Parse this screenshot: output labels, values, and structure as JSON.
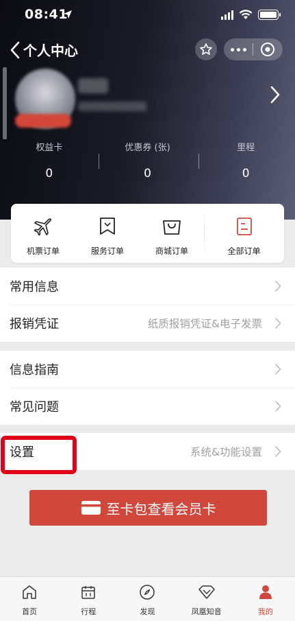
{
  "status_bar": {
    "time": "08:41"
  },
  "nav": {
    "title": "个人中心"
  },
  "stats": [
    {
      "label": "权益卡",
      "value": "0"
    },
    {
      "label": "优惠券 (张)",
      "value": "0"
    },
    {
      "label": "里程",
      "value": "0"
    }
  ],
  "orders": [
    {
      "label": "机票订单",
      "icon": "plane-icon"
    },
    {
      "label": "服务订单",
      "icon": "bookmark-icon"
    },
    {
      "label": "商城订单",
      "icon": "shopping-bag-icon"
    },
    {
      "label": "全部订单",
      "icon": "order-list-icon"
    }
  ],
  "list": {
    "common_info": {
      "title": "常用信息"
    },
    "reimbursement": {
      "title": "报销凭证",
      "subtitle": "纸质报销凭证&电子发票"
    },
    "info_guide": {
      "title": "信息指南"
    },
    "faq": {
      "title": "常见问题"
    },
    "settings": {
      "title": "设置",
      "subtitle": "系统&功能设置"
    }
  },
  "card_button": {
    "label": "至卡包查看会员卡"
  },
  "tabs": [
    {
      "label": "首页",
      "icon": "home-icon"
    },
    {
      "label": "行程",
      "icon": "calendar-icon"
    },
    {
      "label": "发现",
      "icon": "compass-icon"
    },
    {
      "label": "凤凰知音",
      "icon": "diamond-icon"
    },
    {
      "label": "我的",
      "icon": "user-icon",
      "active": true
    }
  ],
  "colors": {
    "accent": "#d2473b",
    "highlight_border": "#e0001a",
    "header_dark": "#0b0b12"
  }
}
